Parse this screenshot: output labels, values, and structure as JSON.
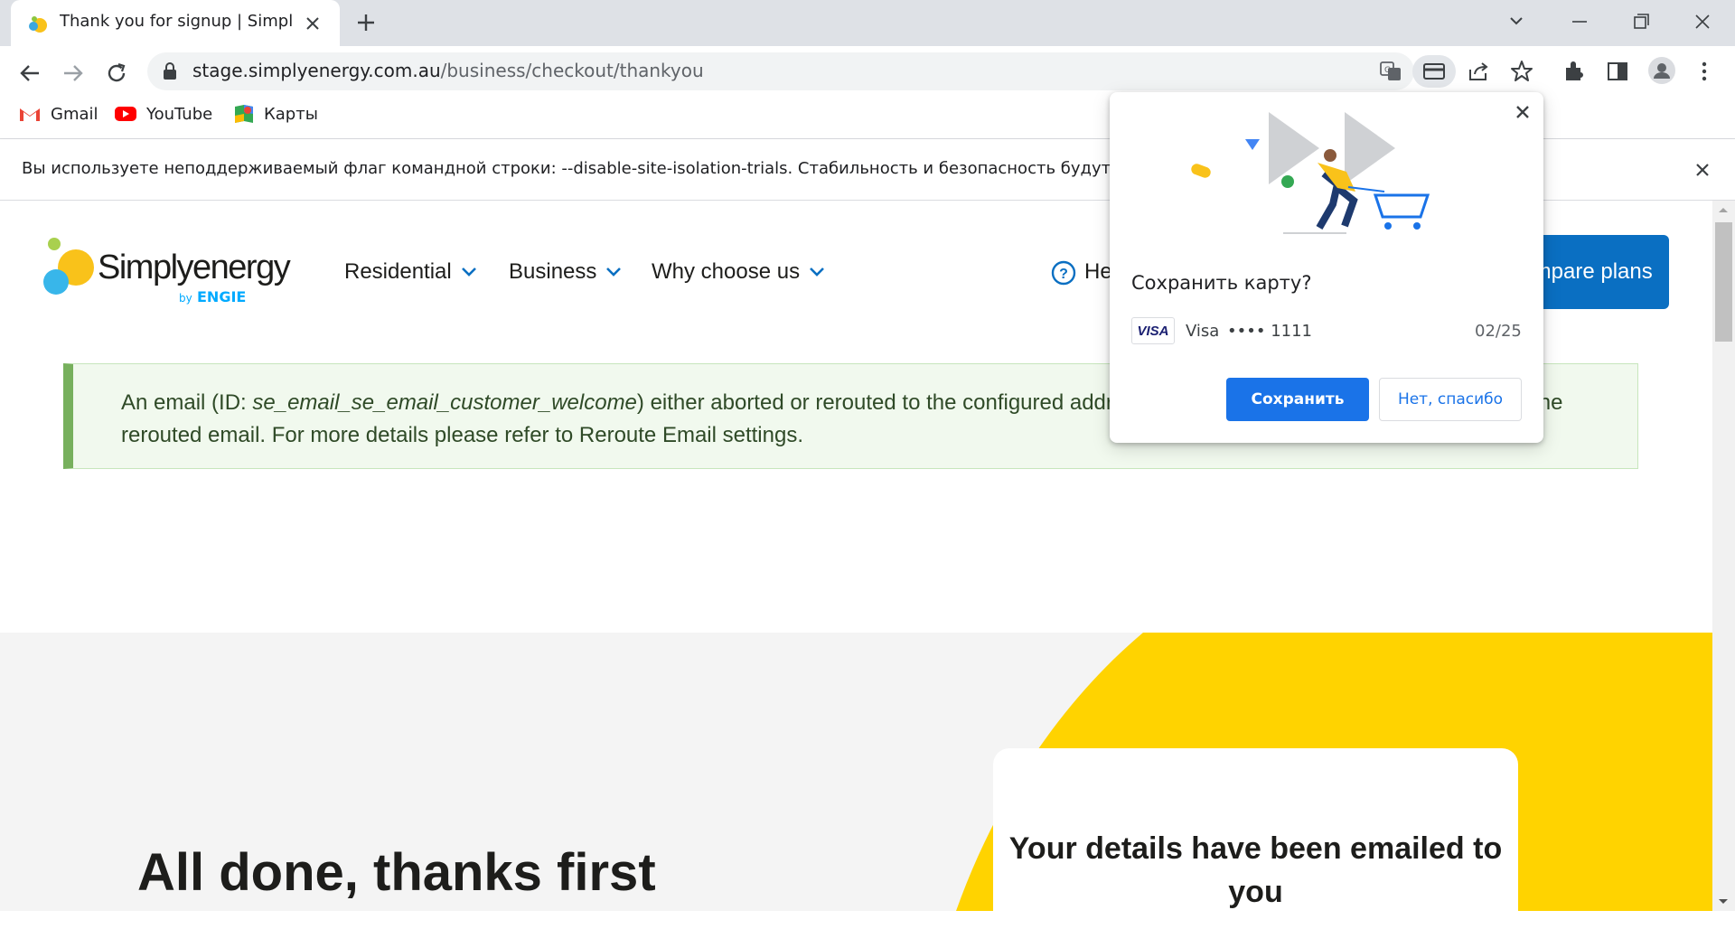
{
  "browser": {
    "tab_title": "Thank you for signup | Simply Energy",
    "url_host": "stage.simplyenergy.com.au",
    "url_path": "/business/checkout/thankyou",
    "bookmarks": [
      {
        "label": "Gmail",
        "icon": "gmail-icon"
      },
      {
        "label": "YouTube",
        "icon": "youtube-icon"
      },
      {
        "label": "Карты",
        "icon": "maps-icon"
      }
    ],
    "infobar_text": "Вы используете неподдерживаемый флаг командной строки: --disable-site-isolation-trials. Стабильность и безопасность будут нарушены."
  },
  "site": {
    "logo_text": "Simplyenergy",
    "logo_by": "by",
    "logo_engie": "ENGIE",
    "nav": [
      "Residential",
      "Business",
      "Why choose us"
    ],
    "help_label": "Help",
    "compare_label": "Compare plans",
    "alert_text_pre": "An email (ID: ",
    "alert_text_id": "se_email_se_email_customer_welcome",
    "alert_text_post": ") either aborted or rerouted to the configured address. Site log entries for complete details on the rerouted email. For more details please refer to Reroute Email settings.",
    "hero_title": "All done, thanks first",
    "card_title": "Your details have been emailed to you"
  },
  "popup": {
    "title": "Сохранить карту?",
    "card_logo": "VISA",
    "card_brand": "Visa",
    "card_number": "•••• 1111",
    "card_expiry": "02/25",
    "save_label": "Сохранить",
    "decline_label": "Нет, спасибо"
  },
  "colors": {
    "brand_blue": "#0a6fc2",
    "brand_yellow": "#ffd300",
    "chrome_blue": "#1a73e8"
  }
}
